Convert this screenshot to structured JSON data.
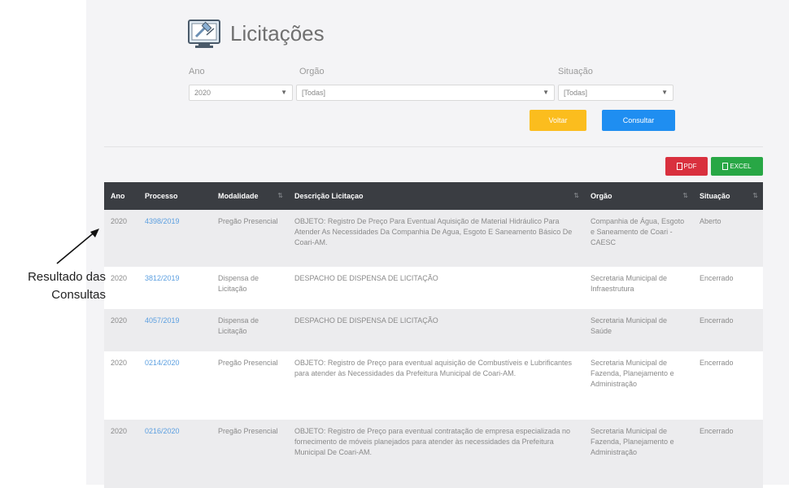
{
  "header": {
    "title": "Licitações",
    "icon": "tender-gavel-icon"
  },
  "filters": {
    "ano": {
      "label": "Ano",
      "value": "2020"
    },
    "orgao": {
      "label": "Orgão",
      "value": "[Todas]"
    },
    "situacao": {
      "label": "Situação",
      "value": "[Todas]"
    }
  },
  "actions": {
    "voltar": "Voltar",
    "consultar": "Consultar"
  },
  "export": {
    "pdf": "PDF",
    "excel": "EXCEL"
  },
  "colors": {
    "voltar": "#fbbd1e",
    "consultar": "#1f8ef1",
    "pdf": "#d9303e",
    "excel": "#28a745",
    "table_header": "#3a3d42",
    "link": "#5b9fe0"
  },
  "table": {
    "columns": [
      "Ano",
      "Processo",
      "Modalidade",
      "Descrição Licitaçao",
      "Orgão",
      "Situação"
    ],
    "rows": [
      {
        "ano": "2020",
        "processo": "4398/2019",
        "modalidade": "Pregão Presencial",
        "descricao": "OBJETO: Registro De Preço Para Eventual Aquisição de Material Hidráulico Para Atender As Necessidades Da Companhia De Agua, Esgoto E Saneamento Básico De Coari-AM.",
        "orgao": "Companhia de Água, Esgoto e Saneamento de Coari - CAESC",
        "situacao": "Aberto"
      },
      {
        "ano": "2020",
        "processo": "3812/2019",
        "modalidade": "Dispensa de Licitação",
        "descricao": "DESPACHO DE DISPENSA DE LICITAÇÃO",
        "orgao": "Secretaria Municipal de Infraestrutura",
        "situacao": "Encerrado"
      },
      {
        "ano": "2020",
        "processo": "4057/2019",
        "modalidade": "Dispensa de Licitação",
        "descricao": "DESPACHO DE DISPENSA DE LICITAÇÃO",
        "orgao": "Secretaria Municipal de Saúde",
        "situacao": "Encerrado"
      },
      {
        "ano": "2020",
        "processo": "0214/2020",
        "modalidade": "Pregão Presencial",
        "descricao": "OBJETO: Registro de Preço para eventual aquisição de Combustíveis e Lubrificantes para atender às Necessidades da Prefeitura Municipal de Coari-AM.",
        "orgao": "Secretaria Municipal de Fazenda, Planejamento e Administração",
        "situacao": "Encerrado"
      },
      {
        "ano": "2020",
        "processo": "0216/2020",
        "modalidade": "Pregão Presencial",
        "descricao": "OBJETO: Registro de Preço para eventual contratação de empresa especializada no fornecimento de móveis planejados para atender às necessidades da Prefeitura Municipal De Coari-AM.",
        "orgao": "Secretaria Municipal de Fazenda, Planejamento e Administração",
        "situacao": "Encerrado"
      }
    ]
  },
  "annotation": {
    "line1": "Resultado das",
    "line2": "Consultas"
  }
}
